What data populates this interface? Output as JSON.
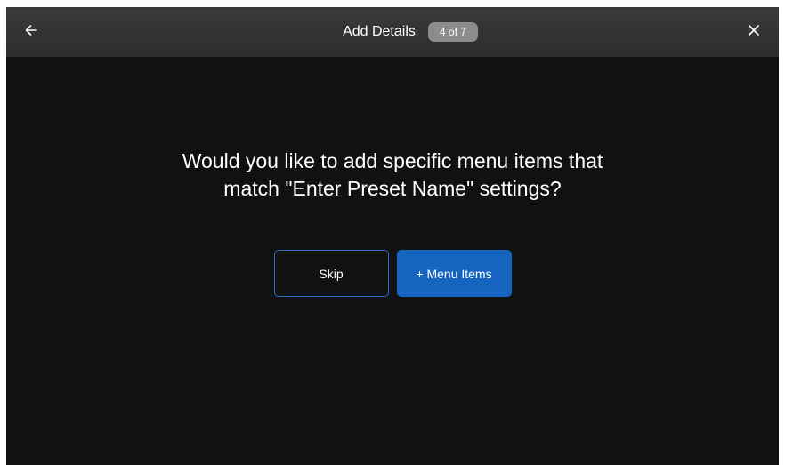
{
  "header": {
    "title": "Add Details",
    "step_badge": "4 of 7",
    "back_icon": "arrow-left-icon",
    "close_icon": "close-icon"
  },
  "main": {
    "question_line1": "Would you like to add specific menu items that",
    "question_line2": "match \"Enter Preset Name\" settings?",
    "skip_label": "Skip",
    "menu_items_label": "+ Menu Items"
  },
  "colors": {
    "background": "#111111",
    "topbar": "#2d2d2d",
    "badge": "#8c8c8c",
    "primary": "#1565c0",
    "outline": "#2a6fc2"
  }
}
